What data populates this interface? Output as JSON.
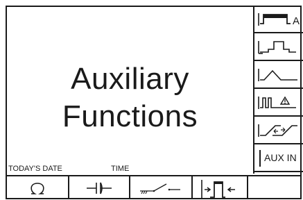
{
  "title": {
    "line1": "Auxiliary",
    "line2": "Functions"
  },
  "labels": {
    "todays_date": "TODAY'S DATE",
    "time": "TIME"
  },
  "softkeys_right": [
    {
      "icon": "square-pulse-abc-icon"
    },
    {
      "icon": "pulse-step-icon"
    },
    {
      "icon": "triangle-wave-icon"
    },
    {
      "icon": "pulse-warning-icon"
    },
    {
      "icon": "ramp-edge-icon"
    },
    {
      "icon": "aux-in-icon",
      "label": "AUX IN"
    }
  ],
  "softkeys_bottom": [
    {
      "icon": "loop-icon"
    },
    {
      "icon": "capacitor-icon"
    },
    {
      "icon": "ground-switch-icon"
    },
    {
      "icon": "pulse-arrow-icon"
    },
    {
      "icon": "blank"
    }
  ]
}
